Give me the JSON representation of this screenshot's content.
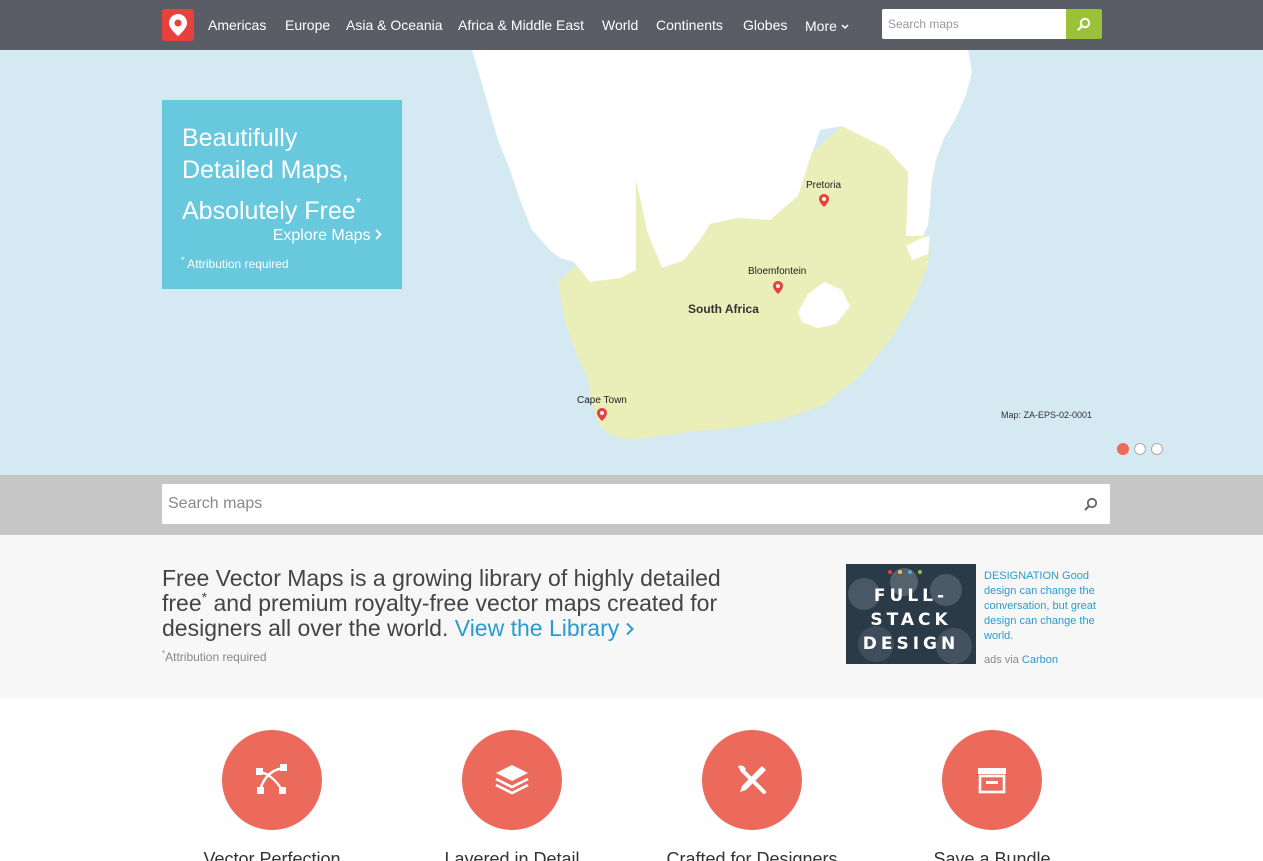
{
  "nav": {
    "logo_icon": "map-pin-icon",
    "items": [
      "Americas",
      "Europe",
      "Asia & Oceania",
      "Africa & Middle East",
      "World",
      "Continents",
      "Globes",
      "More"
    ],
    "search_placeholder": "Search maps",
    "search_icon": "search-icon"
  },
  "hero": {
    "promo": {
      "title_line1": "Beautifully",
      "title_line2": "Detailed Maps,",
      "title_line3": "Absolutely Free",
      "title_asterisk": "*",
      "link": "Explore Maps",
      "note_asterisk": "*",
      "note": "Attribution required"
    },
    "map": {
      "cities": [
        "Pretoria",
        "Bloemfontein",
        "Cape Town"
      ],
      "country": "South Africa",
      "map_id": "Map: ZA-EPS-02-0001"
    },
    "slide_count": 3,
    "active_slide": 1
  },
  "search": {
    "placeholder": "Search maps"
  },
  "intro": {
    "text_part1": "Free Vector Maps is a growing library of highly detailed free",
    "asterisk": "*",
    "text_part2": " and premium royalty-free vector maps created for designers all over the world. ",
    "link": "View the Library",
    "note_asterisk": "*",
    "note": "Attribution required"
  },
  "ad": {
    "image_line1": "FULL-",
    "image_line2": "STACK",
    "image_line3": "DESIGN",
    "text": "DESIGNATION Good design can change the conversation, but great design can change the world.",
    "via": "ads via",
    "carbon": "Carbon"
  },
  "features": [
    {
      "title": "Vector Perfection",
      "icon": "vector-pen-icon"
    },
    {
      "title": "Layered in Detail",
      "icon": "layers-icon"
    },
    {
      "title": "Crafted for Designers",
      "icon": "pencil-brush-icon"
    },
    {
      "title": "Save a Bundle",
      "icon": "archive-box-icon"
    }
  ],
  "colors": {
    "nav_bg": "#5b5d66",
    "logo": "#e8403d",
    "search_button": "#9ac138",
    "promo_bg": "#67c8de",
    "ocean": "#d4e9f2",
    "country": "#eaefb9",
    "accent": "#ec6a5c",
    "link": "#2a9bd0"
  }
}
